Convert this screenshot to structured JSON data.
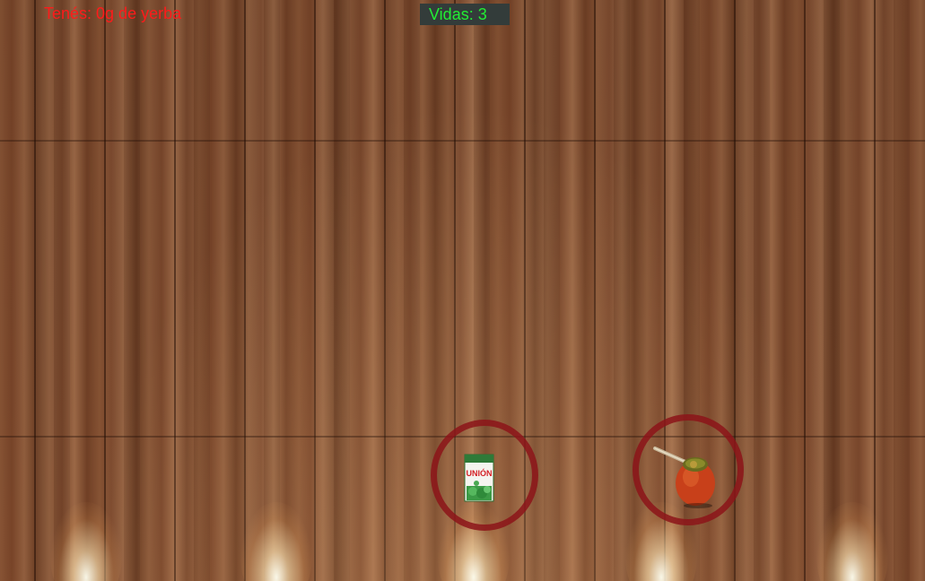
{
  "hud": {
    "score_text": "Tenés: 0g de yerba",
    "score_color": "#ff1a1a",
    "lives_text": "Vidas: 3",
    "lives_color": "#22ee33"
  },
  "game": {
    "yerba_grams": 0,
    "lives": 3
  },
  "items": {
    "yerba_pack_label": "UNIÓN",
    "yerba_pack_icon": "yerba-pack-icon",
    "mate_icon": "mate-gourd-icon"
  },
  "colors": {
    "ring": "#8c1419",
    "floor": "#7a4a30"
  }
}
